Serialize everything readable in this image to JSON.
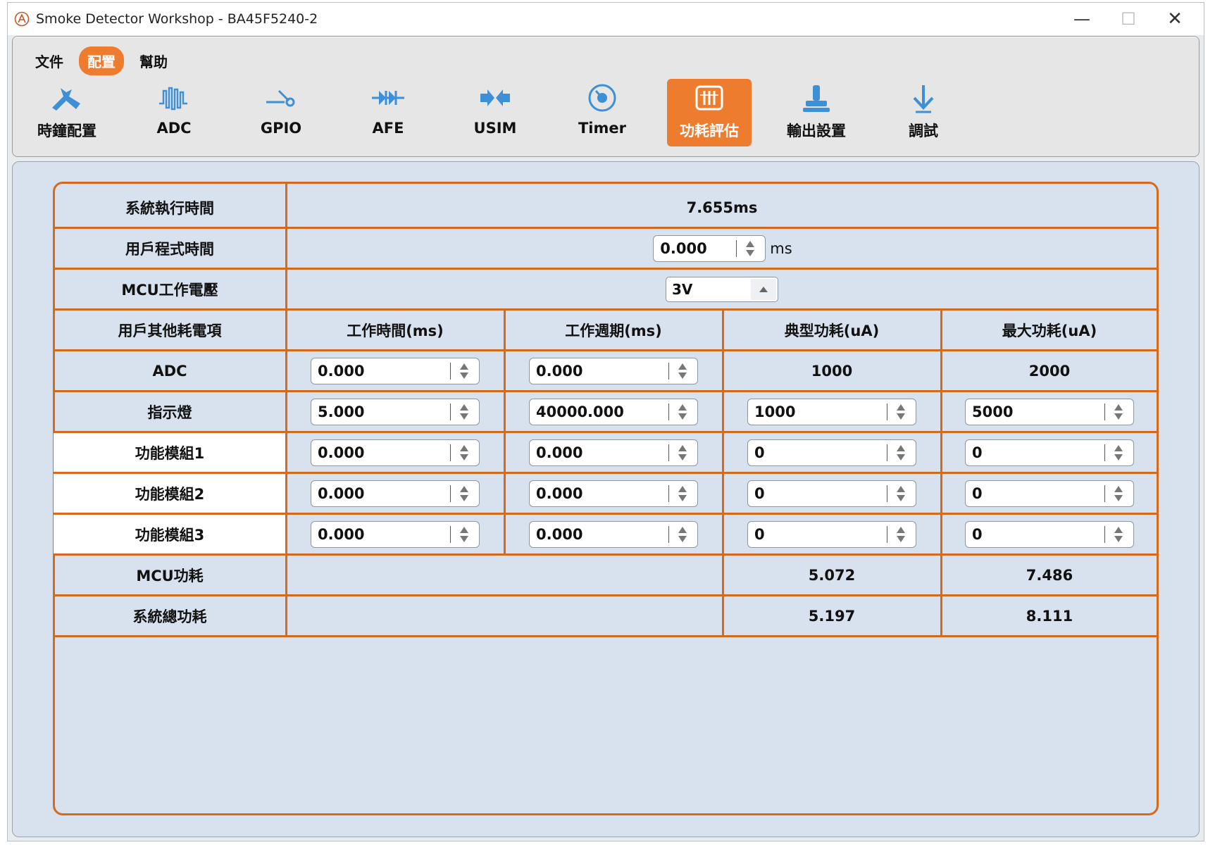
{
  "window": {
    "title": "Smoke Detector Workshop - BA45F5240-2",
    "controls": {
      "minimize": "—",
      "maximize": "☐",
      "close": "✕"
    }
  },
  "menu": {
    "items": [
      {
        "label": "文件",
        "active": false
      },
      {
        "label": "配置",
        "active": true
      },
      {
        "label": "幫助",
        "active": false
      }
    ]
  },
  "toolbar": {
    "tools": [
      {
        "label": "時鐘配置",
        "icon": "clock-config-icon"
      },
      {
        "label": "ADC",
        "icon": "adc-icon"
      },
      {
        "label": "GPIO",
        "icon": "gpio-icon"
      },
      {
        "label": "AFE",
        "icon": "afe-icon"
      },
      {
        "label": "USIM",
        "icon": "usim-icon"
      },
      {
        "label": "Timer",
        "icon": "timer-icon"
      },
      {
        "label": "功耗評估",
        "icon": "power-estimate-icon",
        "active": true
      },
      {
        "label": "輸出設置",
        "icon": "output-settings-icon"
      },
      {
        "label": "調試",
        "icon": "debug-icon"
      }
    ]
  },
  "colors": {
    "accent": "#ee7c2f",
    "border": "#d56a1d",
    "panel_bg": "#d8e1ee",
    "icon_blue": "#3d8fd6"
  },
  "power": {
    "system_time": {
      "label": "系統執行時間",
      "value": "7.655ms"
    },
    "user_time": {
      "label": "用戶程式時間",
      "value": "0.000",
      "unit": "ms"
    },
    "mcu_voltage": {
      "label": "MCU工作電壓",
      "value": "3V"
    },
    "headers": {
      "item": "用戶其他耗電項",
      "work_time": "工作時間(ms)",
      "work_period": "工作週期(ms)",
      "typical": "典型功耗(uA)",
      "max": "最大功耗(uA)"
    },
    "rows": [
      {
        "label": "ADC",
        "work_time": "0.000",
        "work_period": "0.000",
        "typical": "1000",
        "max": "2000"
      },
      {
        "label": "指示燈",
        "work_time": "5.000",
        "work_period": "40000.000",
        "typical": "1000",
        "max": "5000"
      },
      {
        "label": "功能模組1",
        "work_time": "0.000",
        "work_period": "0.000",
        "typical": "0",
        "max": "0"
      },
      {
        "label": "功能模組2",
        "work_time": "0.000",
        "work_period": "0.000",
        "typical": "0",
        "max": "0"
      },
      {
        "label": "功能模組3",
        "work_time": "0.000",
        "work_period": "0.000",
        "typical": "0",
        "max": "0"
      }
    ],
    "mcu_power": {
      "label": "MCU功耗",
      "typical": "5.072",
      "max": "7.486"
    },
    "system_power": {
      "label": "系統總功耗",
      "typical": "5.197",
      "max": "8.111"
    }
  }
}
